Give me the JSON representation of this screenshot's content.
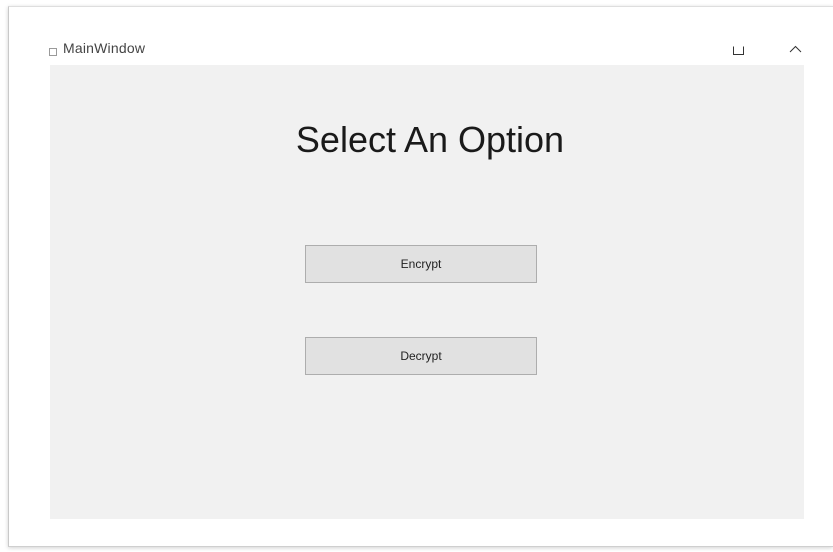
{
  "window": {
    "title": "MainWindow"
  },
  "titlebar": {
    "controls": [
      {
        "name": "maximize",
        "icon": "maximize-icon"
      },
      {
        "name": "collapse",
        "icon": "chevron-up-icon"
      }
    ]
  },
  "main": {
    "heading": "Select An Option",
    "encrypt_label": "Encrypt",
    "decrypt_label": "Decrypt"
  },
  "colors": {
    "client_background": "#f1f1f1",
    "button_background": "#e1e1e1",
    "button_border": "#adadad"
  }
}
